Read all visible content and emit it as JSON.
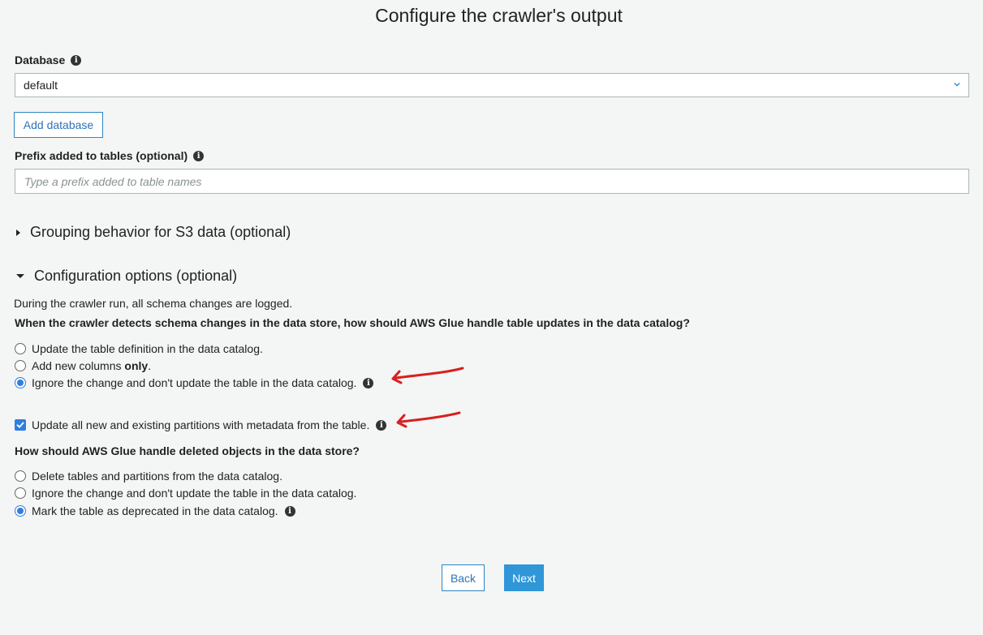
{
  "page_title": "Configure the crawler's output",
  "database": {
    "label": "Database",
    "selected": "default",
    "add_button": "Add database"
  },
  "prefix": {
    "label": "Prefix added to tables (optional)",
    "placeholder": "Type a prefix added to table names"
  },
  "grouping": {
    "label": "Grouping behavior for S3 data (optional)",
    "expanded": false
  },
  "config": {
    "label": "Configuration options (optional)",
    "expanded": true,
    "note": "During the crawler run, all schema changes are logged.",
    "schema_question": "When the crawler detects schema changes in the data store, how should AWS Glue handle table updates in the data catalog?",
    "schema_options": [
      {
        "label": "Update the table definition in the data catalog.",
        "selected": false
      },
      {
        "label_prefix": "Add new columns ",
        "label_bold": "only",
        "label_suffix": ".",
        "selected": false
      },
      {
        "label": "Ignore the change and don't update the table in the data catalog.",
        "selected": true
      }
    ],
    "partition_checkbox": {
      "label": "Update all new and existing partitions with metadata from the table.",
      "checked": true
    },
    "delete_question": "How should AWS Glue handle deleted objects in the data store?",
    "delete_options": [
      {
        "label": "Delete tables and partitions from the data catalog.",
        "selected": false
      },
      {
        "label": "Ignore the change and don't update the table in the data catalog.",
        "selected": false
      },
      {
        "label": "Mark the table as deprecated in the data catalog.",
        "selected": true
      }
    ]
  },
  "footer": {
    "back": "Back",
    "next": "Next"
  },
  "colors": {
    "accent": "#2f96d8",
    "annotation": "#d62020",
    "background": "#f4f5f5"
  }
}
